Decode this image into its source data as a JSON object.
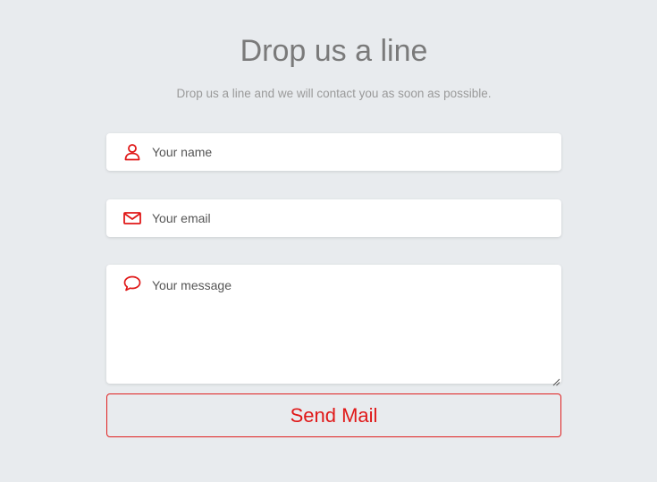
{
  "header": {
    "title": "Drop us a line",
    "subtitle": "Drop us a line and we will contact you as soon as possible."
  },
  "form": {
    "name": {
      "placeholder": "Your name",
      "value": "",
      "icon": "user-icon"
    },
    "email": {
      "placeholder": "Your email",
      "value": "",
      "icon": "envelope-icon"
    },
    "message": {
      "placeholder": "Your message",
      "value": "",
      "icon": "speech-bubble-icon"
    },
    "submit_label": "Send Mail"
  },
  "colors": {
    "accent": "#e01818",
    "background": "#e8ebee",
    "title": "#7a7a7a",
    "subtitle": "#9a9a9a"
  }
}
